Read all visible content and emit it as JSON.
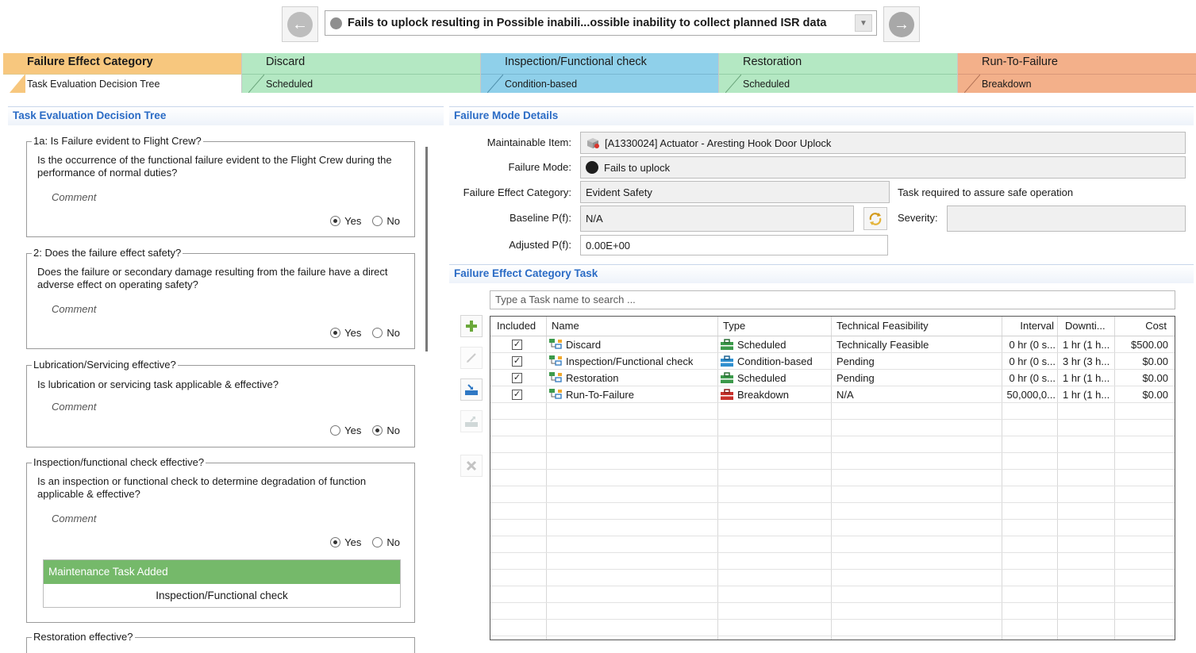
{
  "navigator": {
    "selected_failure_mode": "Fails to uplock resulting in Possible inabili...ossible inability to collect planned ISR data"
  },
  "category_tabs": [
    {
      "title": "Failure Effect Category",
      "subtitle": "Task Evaluation Decision Tree",
      "color": "#f7c77e"
    },
    {
      "title": "Discard",
      "subtitle": "Scheduled",
      "color": "#b4e8c3"
    },
    {
      "title": "Inspection/Functional check",
      "subtitle": "Condition-based",
      "color": "#8fd0ea"
    },
    {
      "title": "Restoration",
      "subtitle": "Scheduled",
      "color": "#b4e8c3"
    },
    {
      "title": "Run-To-Failure",
      "subtitle": "Breakdown",
      "color": "#f3b08a"
    }
  ],
  "decision_tree": {
    "header": "Task Evaluation Decision Tree",
    "questions": [
      {
        "title": "1a: Is Failure evident to Flight Crew?",
        "text": "Is the occurrence of the functional failure evident to the Flight Crew during the performance of normal duties?",
        "comment": "Comment",
        "answer": "Yes"
      },
      {
        "title": "2: Does the failure effect safety?",
        "text": "Does the failure or secondary damage resulting from the failure have a direct adverse effect on operating safety?",
        "comment": "Comment",
        "answer": "Yes"
      },
      {
        "title": "Lubrication/Servicing effective?",
        "text": "Is lubrication or servicing task applicable & effective?",
        "comment": "Comment",
        "answer": "No"
      },
      {
        "title": "Inspection/functional check effective?",
        "text": "Is an inspection or functional check to determine degradation of function applicable & effective?",
        "comment": "Comment",
        "answer": "Yes",
        "task_added_header": "Maintenance Task Added",
        "task_added_value": "Inspection/Functional check"
      },
      {
        "title": "Restoration effective?"
      }
    ],
    "yes_label": "Yes",
    "no_label": "No"
  },
  "failure_mode_details": {
    "header": "Failure Mode Details",
    "maintainable_item_label": "Maintainable Item:",
    "maintainable_item": "[A1330024] Actuator - Aresting Hook Door Uplock",
    "failure_mode_label": "Failure Mode:",
    "failure_mode": "Fails to uplock",
    "fec_label": "Failure Effect Category:",
    "fec": "Evident Safety",
    "fec_note": "Task required to assure safe operation",
    "baseline_label": "Baseline P(f):",
    "baseline": "N/A",
    "severity_label": "Severity:",
    "severity": "",
    "adjusted_label": "Adjusted P(f):",
    "adjusted": "0.00E+00"
  },
  "task_section": {
    "header": "Failure Effect Category Task",
    "search_placeholder": "Type a Task name to search ...",
    "columns": [
      "Included",
      "Name",
      "Type",
      "Technical Feasibility",
      "Interval",
      "Downti...",
      "Cost"
    ],
    "rows": [
      {
        "included": true,
        "name": "Discard",
        "type": "Scheduled",
        "type_color": "#3c9a4b",
        "feasibility": "Technically Feasible",
        "interval": "0 hr (0 s...",
        "downtime": "1 hr (1 h...",
        "cost": "$500.00"
      },
      {
        "included": true,
        "name": "Inspection/Functional check",
        "type": "Condition-based",
        "type_color": "#2f8fcf",
        "feasibility": "Pending",
        "interval": "0 hr (0 s...",
        "downtime": "3 hr (3 h...",
        "cost": "$0.00"
      },
      {
        "included": true,
        "name": "Restoration",
        "type": "Scheduled",
        "type_color": "#3c9a4b",
        "feasibility": "Pending",
        "interval": "0 hr (0 s...",
        "downtime": "1 hr (1 h...",
        "cost": "$0.00"
      },
      {
        "included": true,
        "name": "Run-To-Failure",
        "type": "Breakdown",
        "type_color": "#c8322d",
        "feasibility": "N/A",
        "interval": "50,000,0...",
        "downtime": "1 hr (1 h...",
        "cost": "$0.00"
      }
    ]
  }
}
